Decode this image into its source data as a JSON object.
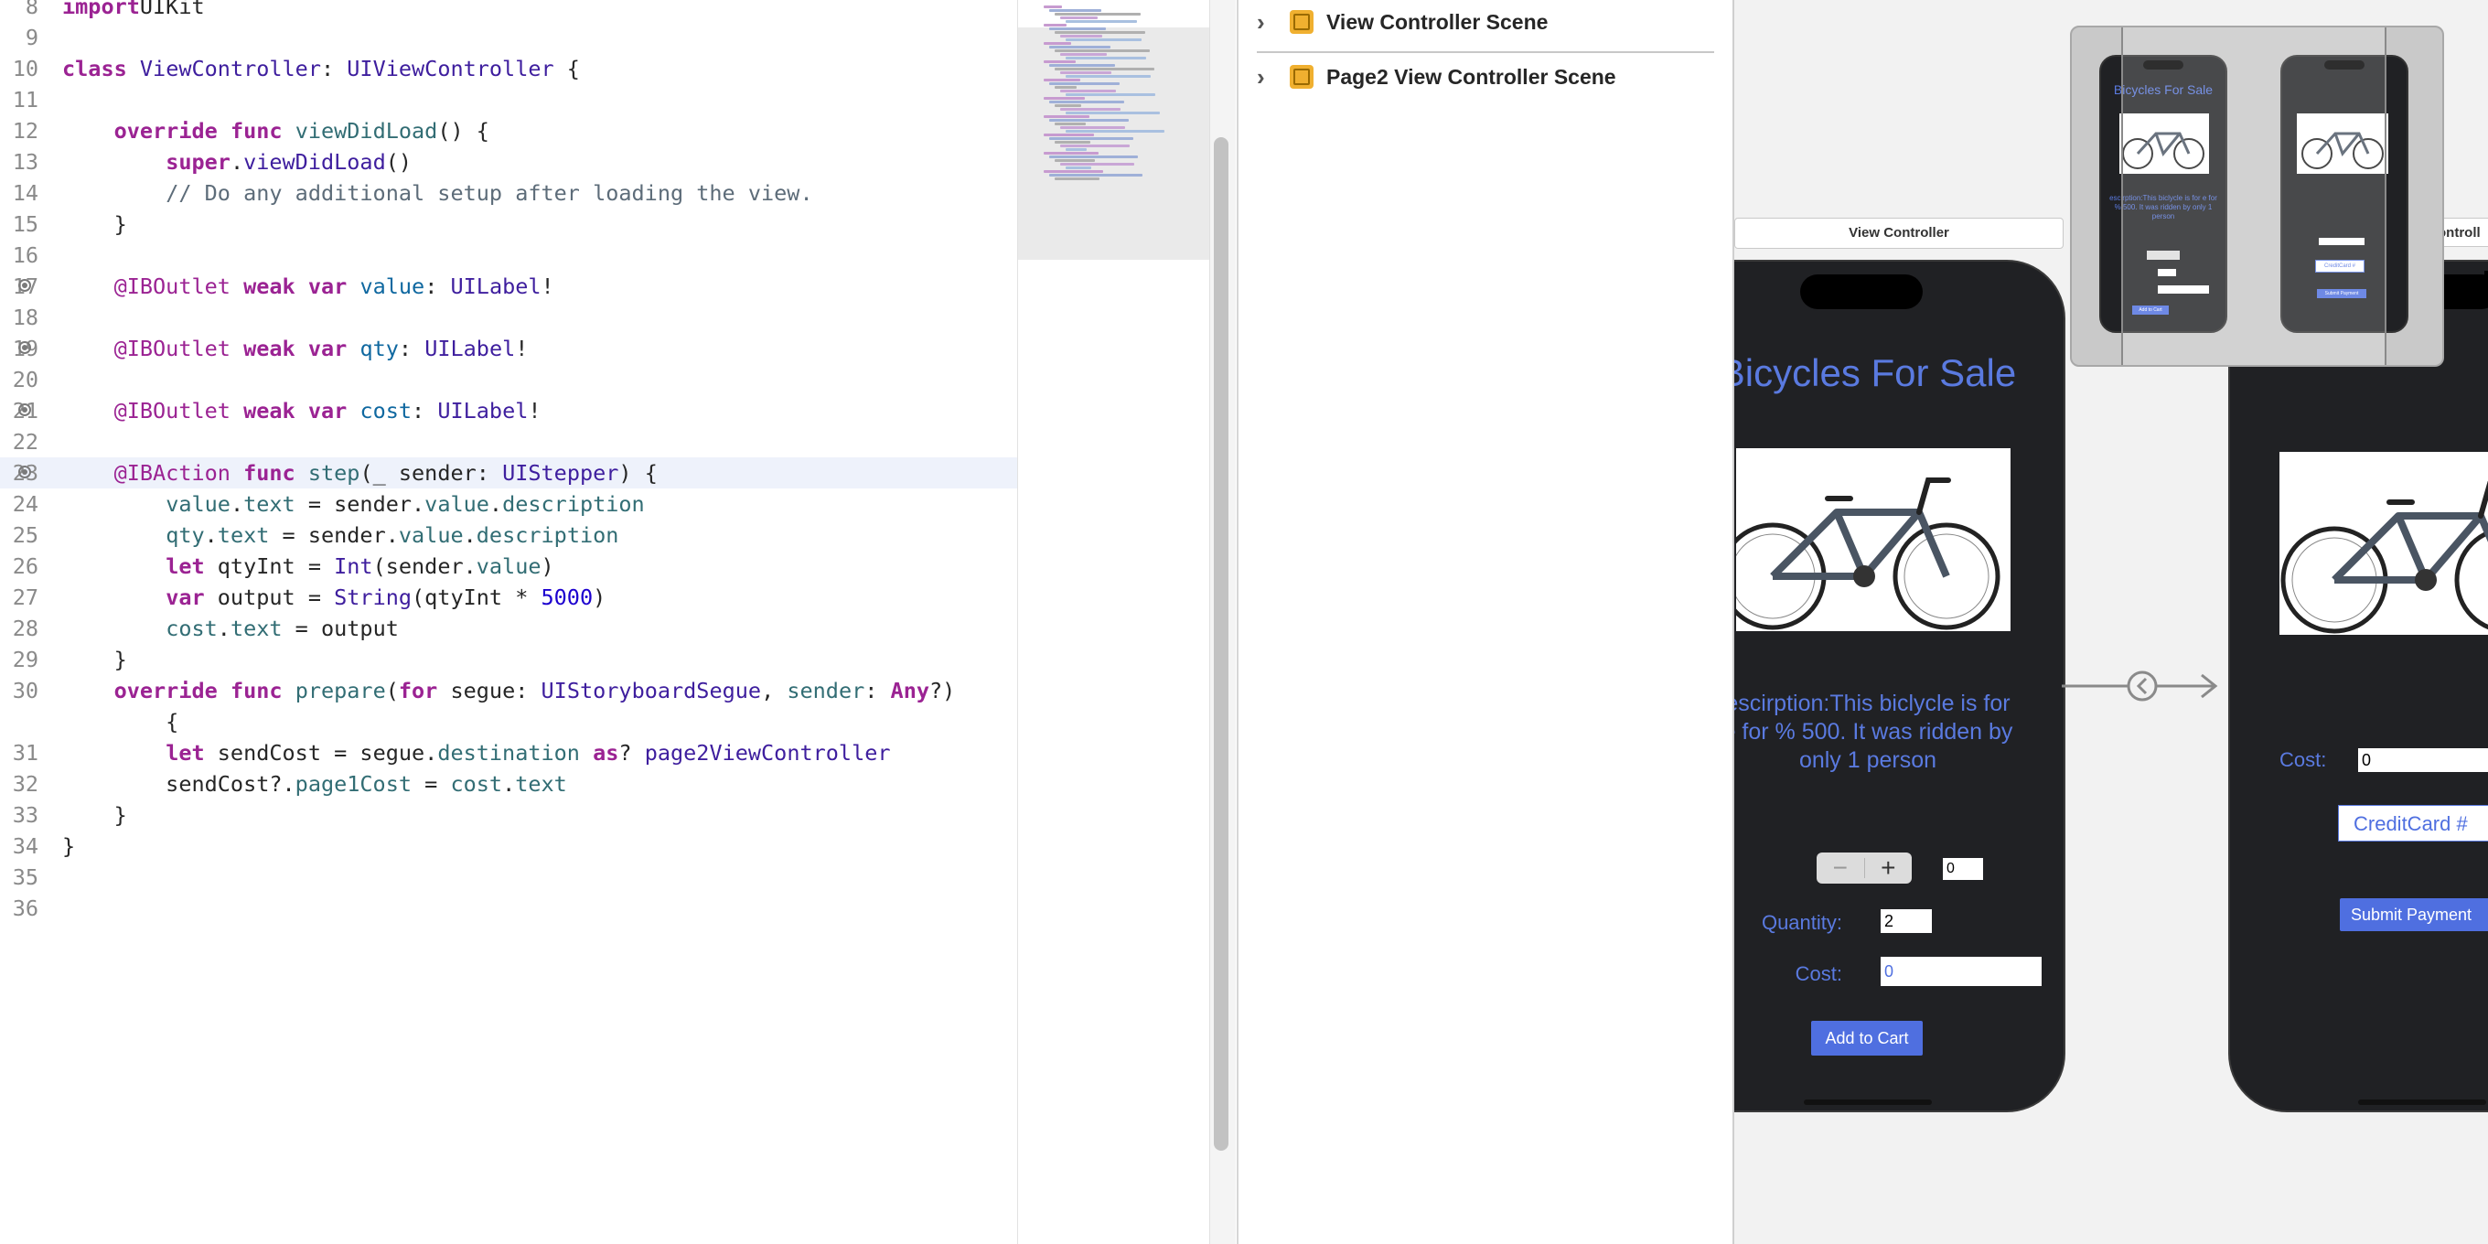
{
  "editor": {
    "lines": [
      {
        "n": "8",
        "bp": false,
        "hl": false,
        "tokens": [
          [
            "kw",
            "import"
          ],
          [
            "",
            "UIKit"
          ]
        ]
      },
      {
        "n": "9",
        "bp": false,
        "hl": false,
        "tokens": []
      },
      {
        "n": "10",
        "bp": false,
        "hl": false,
        "tokens": [
          [
            "kw",
            "class"
          ],
          [
            "",
            " "
          ],
          [
            "ty",
            "ViewController"
          ],
          [
            "",
            ": "
          ],
          [
            "ty",
            "UIViewController"
          ],
          [
            "",
            " {"
          ]
        ]
      },
      {
        "n": "11",
        "bp": false,
        "hl": false,
        "tokens": []
      },
      {
        "n": "12",
        "bp": false,
        "hl": false,
        "tokens": [
          [
            "",
            "    "
          ],
          [
            "kw",
            "override"
          ],
          [
            "",
            " "
          ],
          [
            "kw",
            "func"
          ],
          [
            "",
            " "
          ],
          [
            "fn",
            "viewDidLoad"
          ],
          [
            "",
            "() {"
          ]
        ]
      },
      {
        "n": "13",
        "bp": false,
        "hl": false,
        "tokens": [
          [
            "",
            "        "
          ],
          [
            "kw",
            "super"
          ],
          [
            "",
            "."
          ],
          [
            "ty",
            "viewDidLoad"
          ],
          [
            "",
            "()"
          ]
        ]
      },
      {
        "n": "14",
        "bp": false,
        "hl": false,
        "tokens": [
          [
            "",
            "        "
          ],
          [
            "cm",
            "// Do any additional setup after loading the view."
          ]
        ]
      },
      {
        "n": "15",
        "bp": false,
        "hl": false,
        "tokens": [
          [
            "",
            "    }"
          ]
        ]
      },
      {
        "n": "16",
        "bp": false,
        "hl": false,
        "tokens": []
      },
      {
        "n": "17",
        "bp": true,
        "hl": false,
        "tokens": [
          [
            "",
            "    "
          ],
          [
            "at",
            "@IBOutlet"
          ],
          [
            "",
            " "
          ],
          [
            "kw",
            "weak"
          ],
          [
            "",
            " "
          ],
          [
            "kw",
            "var"
          ],
          [
            "",
            " "
          ],
          [
            "vr",
            "value"
          ],
          [
            "",
            ": "
          ],
          [
            "ty",
            "UILabel"
          ],
          [
            "",
            "!"
          ]
        ]
      },
      {
        "n": "18",
        "bp": false,
        "hl": false,
        "tokens": []
      },
      {
        "n": "19",
        "bp": true,
        "hl": false,
        "tokens": [
          [
            "",
            "    "
          ],
          [
            "at",
            "@IBOutlet"
          ],
          [
            "",
            " "
          ],
          [
            "kw",
            "weak"
          ],
          [
            "",
            " "
          ],
          [
            "kw",
            "var"
          ],
          [
            "",
            " "
          ],
          [
            "vr",
            "qty"
          ],
          [
            "",
            ": "
          ],
          [
            "ty",
            "UILabel"
          ],
          [
            "",
            "!"
          ]
        ]
      },
      {
        "n": "20",
        "bp": false,
        "hl": false,
        "tokens": []
      },
      {
        "n": "21",
        "bp": true,
        "hl": false,
        "tokens": [
          [
            "",
            "    "
          ],
          [
            "at",
            "@IBOutlet"
          ],
          [
            "",
            " "
          ],
          [
            "kw",
            "weak"
          ],
          [
            "",
            " "
          ],
          [
            "kw",
            "var"
          ],
          [
            "",
            " "
          ],
          [
            "vr",
            "cost"
          ],
          [
            "",
            ": "
          ],
          [
            "ty",
            "UILabel"
          ],
          [
            "",
            "!"
          ]
        ]
      },
      {
        "n": "22",
        "bp": false,
        "hl": false,
        "tokens": []
      },
      {
        "n": "23",
        "bp": true,
        "hl": true,
        "tokens": [
          [
            "",
            "    "
          ],
          [
            "at",
            "@IBAction"
          ],
          [
            "",
            " "
          ],
          [
            "kw",
            "func"
          ],
          [
            "",
            " "
          ],
          [
            "fn",
            "step"
          ],
          [
            "",
            "(_ sender: "
          ],
          [
            "ty",
            "UIStepper"
          ],
          [
            "",
            ") {"
          ]
        ]
      },
      {
        "n": "24",
        "bp": false,
        "hl": false,
        "tokens": [
          [
            "",
            "        "
          ],
          [
            "id",
            "value"
          ],
          [
            "",
            "."
          ],
          [
            "pr",
            "text"
          ],
          [
            "",
            " = sender."
          ],
          [
            "pr",
            "value"
          ],
          [
            "",
            "."
          ],
          [
            "pr",
            "description"
          ]
        ]
      },
      {
        "n": "25",
        "bp": false,
        "hl": false,
        "tokens": [
          [
            "",
            "        "
          ],
          [
            "id",
            "qty"
          ],
          [
            "",
            "."
          ],
          [
            "pr",
            "text"
          ],
          [
            "",
            " = sender."
          ],
          [
            "pr",
            "value"
          ],
          [
            "",
            "."
          ],
          [
            "pr",
            "description"
          ]
        ]
      },
      {
        "n": "26",
        "bp": false,
        "hl": false,
        "tokens": [
          [
            "",
            "        "
          ],
          [
            "kw",
            "let"
          ],
          [
            "",
            " qtyInt = "
          ],
          [
            "ty",
            "Int"
          ],
          [
            "",
            "(sender."
          ],
          [
            "pr",
            "value"
          ],
          [
            "",
            ")"
          ]
        ]
      },
      {
        "n": "27",
        "bp": false,
        "hl": false,
        "tokens": [
          [
            "",
            "        "
          ],
          [
            "kw",
            "var"
          ],
          [
            "",
            " output = "
          ],
          [
            "ty",
            "String"
          ],
          [
            "",
            "(qtyInt * "
          ],
          [
            "nm",
            "5000"
          ],
          [
            "",
            ")"
          ]
        ]
      },
      {
        "n": "28",
        "bp": false,
        "hl": false,
        "tokens": [
          [
            "",
            "        "
          ],
          [
            "id",
            "cost"
          ],
          [
            "",
            "."
          ],
          [
            "pr",
            "text"
          ],
          [
            "",
            " = output"
          ]
        ]
      },
      {
        "n": "29",
        "bp": false,
        "hl": false,
        "tokens": [
          [
            "",
            "    }"
          ]
        ]
      },
      {
        "n": "30",
        "bp": false,
        "hl": false,
        "tokens": [
          [
            "",
            "    "
          ],
          [
            "kw",
            "override"
          ],
          [
            "",
            " "
          ],
          [
            "kw",
            "func"
          ],
          [
            "",
            " "
          ],
          [
            "fn",
            "prepare"
          ],
          [
            "",
            "("
          ],
          [
            "kw",
            "for"
          ],
          [
            "",
            " segue: "
          ],
          [
            "ty",
            "UIStoryboardSegue"
          ],
          [
            "",
            ", "
          ],
          [
            "pr",
            "sender"
          ],
          [
            "",
            ": "
          ],
          [
            "kw",
            "Any"
          ],
          [
            "",
            "?)"
          ]
        ]
      },
      {
        "n": "",
        "bp": false,
        "hl": false,
        "tokens": [
          [
            "",
            "        {"
          ]
        ]
      },
      {
        "n": "31",
        "bp": false,
        "hl": false,
        "tokens": [
          [
            "",
            "        "
          ],
          [
            "kw",
            "let"
          ],
          [
            "",
            " sendCost = segue."
          ],
          [
            "pr",
            "destination"
          ],
          [
            "",
            " "
          ],
          [
            "kw",
            "as"
          ],
          [
            "",
            "? "
          ],
          [
            "ty",
            "page2ViewController"
          ]
        ]
      },
      {
        "n": "32",
        "bp": false,
        "hl": false,
        "tokens": [
          [
            "",
            "        sendCost?."
          ],
          [
            "pr",
            "page1Cost"
          ],
          [
            "",
            " = "
          ],
          [
            "id",
            "cost"
          ],
          [
            "",
            "."
          ],
          [
            "pr",
            "text"
          ]
        ]
      },
      {
        "n": "33",
        "bp": false,
        "hl": false,
        "tokens": [
          [
            "",
            "    }"
          ]
        ]
      },
      {
        "n": "34",
        "bp": false,
        "hl": false,
        "tokens": [
          [
            "",
            "}"
          ]
        ]
      },
      {
        "n": "35",
        "bp": false,
        "hl": false,
        "tokens": []
      },
      {
        "n": "36",
        "bp": false,
        "hl": false,
        "tokens": []
      }
    ]
  },
  "outline": {
    "scenes": [
      {
        "label": "View Controller Scene"
      },
      {
        "label": "Page2 View Controller Scene"
      }
    ]
  },
  "canvas": {
    "vc1_tag": "View Controller",
    "vc2_tag": "ontroll",
    "vc1": {
      "title": "Bicycles For Sale",
      "description_line1": "escirption:This biclycle is for",
      "description_line2": "e for % 500. It was ridden by",
      "description_line3": "only 1 person",
      "stepper_minus": "−",
      "stepper_plus": "+",
      "value_label": "0",
      "quantity_label": "Quantity:",
      "quantity_value": "2",
      "cost_label": "Cost:",
      "cost_value": "0",
      "add_to_cart": "Add to Cart"
    },
    "vc2": {
      "cost_label": "Cost:",
      "cost_value": "0",
      "credit_card": "CreditCard #",
      "submit": "Submit Payment"
    },
    "navigator": {
      "mini_title": "Bicycles For Sale",
      "mini_desc": "escirption:This biclycle is for e for % 500. It was ridden by only 1 person",
      "mini_credit": "CreditCard #",
      "mini_submit": "Submit Payment",
      "mini_add": "Add to Cart"
    }
  },
  "colors": {
    "accent": "#4f6fe0",
    "phone_bg": "#202124",
    "scene_icon": "#f0b030"
  }
}
